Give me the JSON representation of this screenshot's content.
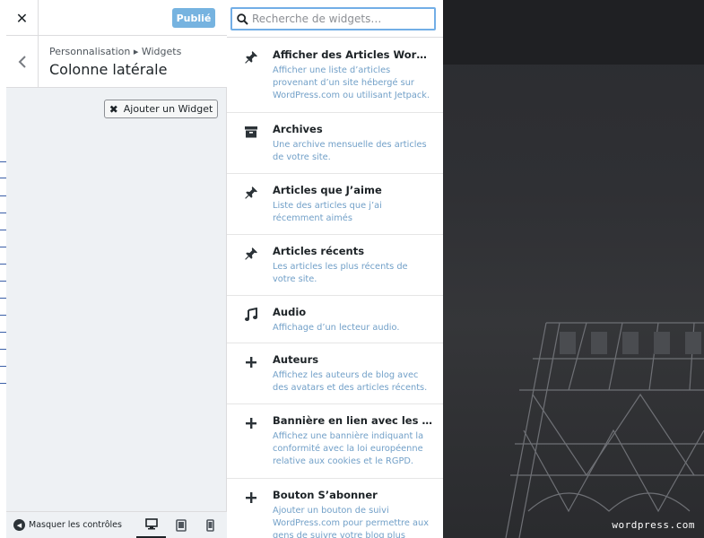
{
  "sidebar": {
    "close_label": "✕",
    "publish_label": "Publié",
    "breadcrumb": "Personnalisation ▸ Widgets",
    "section_title": "Colonne latérale",
    "add_widget_label": "Ajouter un Widget",
    "collapse_label": "Masquer les contrôles",
    "devices": [
      "desktop",
      "tablet",
      "mobile"
    ]
  },
  "search": {
    "placeholder": "Recherche de widgets…",
    "value": ""
  },
  "widgets": [
    {
      "icon": "pin-icon",
      "title": "Afficher des Articles WordPress",
      "desc": "Afficher une liste d’articles provenant d’un site hébergé sur WordPress.com ou utilisant Jetpack."
    },
    {
      "icon": "archive-icon",
      "title": "Archives",
      "desc": "Une archive mensuelle des articles de votre site."
    },
    {
      "icon": "pin-icon",
      "title": "Articles que J’aime",
      "desc": "Liste des articles que j’ai récemment aimés"
    },
    {
      "icon": "pin-icon",
      "title": "Articles récents",
      "desc": "Les articles les plus récents de votre site."
    },
    {
      "icon": "music-icon",
      "title": "Audio",
      "desc": "Affichage d’un lecteur audio."
    },
    {
      "icon": "plus-icon",
      "title": "Auteurs",
      "desc": "Affichez les auteurs de blog avec des avatars et des articles récents."
    },
    {
      "icon": "plus-icon",
      "title": "Bannière en lien avec les cookies",
      "desc": "Affichez une bannière indiquant la conformité avec la loi européenne relative aux cookies et le RGPD."
    },
    {
      "icon": "plus-icon",
      "title": "Bouton S’abonner",
      "desc": "Ajouter un bouton de suivi WordPress.com pour permettre aux gens de suivre votre blog plus facilement"
    }
  ],
  "preview": {
    "watermark": "wordpress.com"
  },
  "colors": {
    "accent": "#72aee6",
    "publish": "#76b3e0",
    "desc_text": "#72a0c8"
  }
}
